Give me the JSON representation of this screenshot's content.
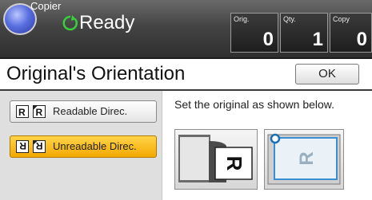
{
  "header": {
    "app_name": "Copier",
    "status": "Ready",
    "counters": [
      {
        "label": "Orig.",
        "value": "0"
      },
      {
        "label": "Qty.",
        "value": "1"
      },
      {
        "label": "Copy",
        "value": "0"
      }
    ]
  },
  "title": "Original's Orientation",
  "ok_label": "OK",
  "options": [
    {
      "label": "Readable Direc.",
      "selected": false
    },
    {
      "label": "Unreadable Direc.",
      "selected": true
    }
  ],
  "instruction": "Set the original as shown below.",
  "illustration_letter": "R",
  "colors": {
    "selected": "#f6b400",
    "header": "#3c3c3c",
    "status_green": "#38d13a"
  }
}
